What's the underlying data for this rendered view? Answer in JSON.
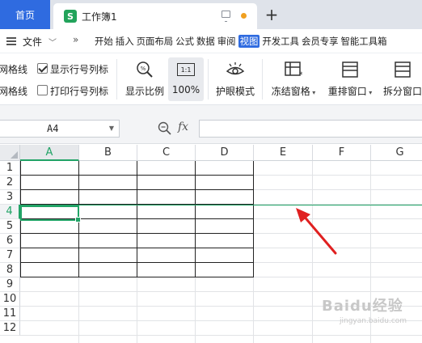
{
  "tabs": {
    "home": "首页",
    "doc_icon": "S",
    "doc_title": "工作簿1",
    "add": "+"
  },
  "menu": {
    "file": "文件",
    "more": "»",
    "items": [
      "开始",
      "插入",
      "页面布局",
      "公式",
      "数据",
      "审阅",
      "视图",
      "开发工具",
      "会员专享",
      "智能工具箱"
    ],
    "active_index": 6
  },
  "ribbon": {
    "gridlines_1": "网格线",
    "gridlines_2": "网格线",
    "show_headers": "显示行号列标",
    "show_headers_checked": true,
    "print_headers": "打印行号列标",
    "print_headers_checked": false,
    "zoom_label": "显示比例",
    "zoom_icon_text": "1:1",
    "zoom_value": "100%",
    "eye_mode": "护眼模式",
    "freeze": "冻结窗格",
    "rearrange": "重排窗口",
    "split": "拆分窗口"
  },
  "formula": {
    "cell_ref": "A4",
    "fx": "fx",
    "value": ""
  },
  "grid": {
    "columns": [
      "A",
      "B",
      "C",
      "D",
      "E",
      "F",
      "G"
    ],
    "rows": [
      "1",
      "2",
      "3",
      "4",
      "5",
      "6",
      "7",
      "8",
      "9",
      "10",
      "11",
      "12"
    ],
    "selected_column": "A",
    "selected_row": "4"
  },
  "watermark": {
    "main": "Baidu经验",
    "sub": "jingyan.baidu.com"
  },
  "colors": {
    "accent": "#2f6be0",
    "selection": "#21a366",
    "arrow": "#e02020"
  }
}
